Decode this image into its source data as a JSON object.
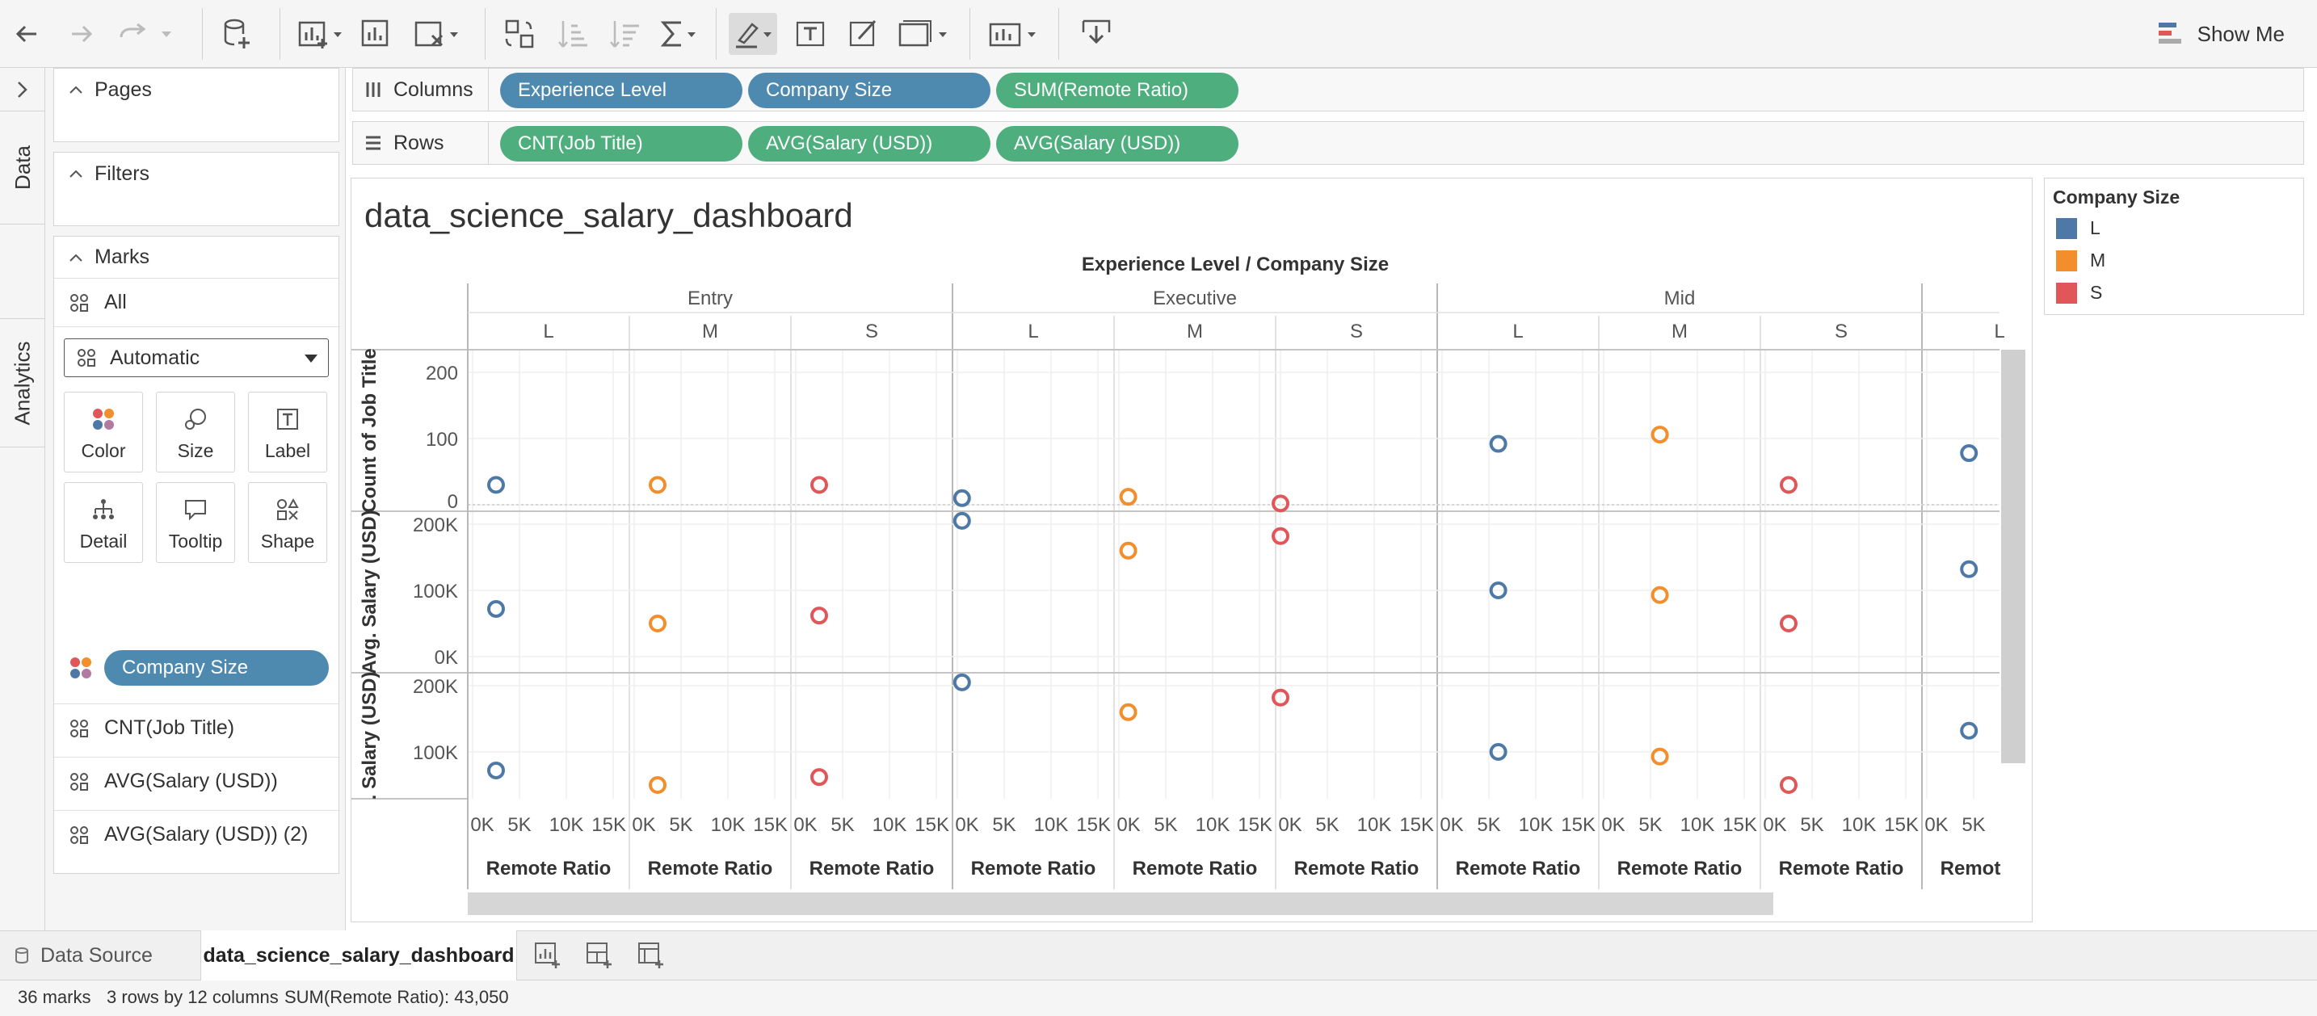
{
  "toolbar": {
    "undo_icon": "undo-arrow-icon",
    "redo_icon": "redo-arrow-icon",
    "show_me_label": "Show Me"
  },
  "side_tabs": {
    "data": "Data",
    "analytics": "Analytics"
  },
  "left_panel": {
    "pages_label": "Pages",
    "filters_label": "Filters",
    "marks_label": "Marks",
    "all_label": "All",
    "mark_type": "Automatic",
    "buttons": {
      "color": "Color",
      "size": "Size",
      "label": "Label",
      "detail": "Detail",
      "tooltip": "Tooltip",
      "shape": "Shape"
    },
    "color_pill": "Company Size",
    "measures": [
      "CNT(Job Title)",
      "AVG(Salary (USD))",
      "AVG(Salary (USD)) (2)"
    ]
  },
  "shelves": {
    "columns_label": "Columns",
    "rows_label": "Rows",
    "columns": [
      "Experience Level",
      "Company Size",
      "SUM(Remote Ratio)"
    ],
    "rows": [
      "CNT(Job Title)",
      "AVG(Salary (USD))",
      "AVG(Salary (USD))"
    ]
  },
  "view": {
    "title": "data_science_salary_dashboard",
    "header_title": "Experience Level / Company Size",
    "experience_levels": [
      "Entry",
      "Executive",
      "Mid",
      ""
    ],
    "company_sizes": [
      "L",
      "M",
      "S",
      "L",
      "M",
      "S",
      "L",
      "M",
      "S",
      "L"
    ],
    "x_tick_labels": [
      "0K",
      "5K",
      "10K",
      "15K"
    ],
    "x_axis_label": "Remote Ratio",
    "last_x_tick_labels": [
      "0K",
      "5K"
    ],
    "last_x_axis_label": "Remot",
    "row_axes": [
      {
        "label": "Count of Job Title",
        "ticks": [
          "200",
          "100",
          "0"
        ]
      },
      {
        "label": "Avg. Salary (USD)",
        "ticks": [
          "200K",
          "100K",
          "0K"
        ]
      },
      {
        "label": ". Salary (USD)",
        "ticks": [
          "200K",
          "100K"
        ]
      }
    ]
  },
  "legend": {
    "title": "Company Size",
    "items": [
      {
        "label": "L",
        "color": "#4e79a7"
      },
      {
        "label": "M",
        "color": "#f28e2b"
      },
      {
        "label": "S",
        "color": "#e15759"
      }
    ]
  },
  "tabs": {
    "data_source": "Data Source",
    "active_sheet": "data_science_salary_dashboard"
  },
  "status": {
    "marks": "36 marks",
    "dims": "3 rows by 12 columns",
    "sum": "SUM(Remote Ratio): 43,050"
  },
  "colors": {
    "L": "#4e79a7",
    "M": "#f28e2b",
    "S": "#e15759",
    "pill_blue": "#4e8aaf",
    "pill_green": "#4eae7d"
  },
  "chart_data": {
    "type": "scatter",
    "xlabel": "Remote Ratio",
    "panels": [
      {
        "level": "Entry",
        "size": "L",
        "remote_ratio": 2500,
        "count": 30,
        "avg_salary": 72000,
        "avg_salary_2": 72000
      },
      {
        "level": "Entry",
        "size": "M",
        "remote_ratio": 2500,
        "count": 30,
        "avg_salary": 50000,
        "avg_salary_2": 50000
      },
      {
        "level": "Entry",
        "size": "S",
        "remote_ratio": 2500,
        "count": 30,
        "avg_salary": 62000,
        "avg_salary_2": 62000
      },
      {
        "level": "Executive",
        "size": "L",
        "remote_ratio": 500,
        "count": 10,
        "avg_salary": 205000,
        "avg_salary_2": 205000
      },
      {
        "level": "Executive",
        "size": "M",
        "remote_ratio": 1000,
        "count": 12,
        "avg_salary": 160000,
        "avg_salary_2": 160000
      },
      {
        "level": "Executive",
        "size": "S",
        "remote_ratio": 0,
        "count": 2,
        "avg_salary": 182000,
        "avg_salary_2": 182000
      },
      {
        "level": "Mid",
        "size": "L",
        "remote_ratio": 6000,
        "count": 92,
        "avg_salary": 100000,
        "avg_salary_2": 100000
      },
      {
        "level": "Mid",
        "size": "M",
        "remote_ratio": 6000,
        "count": 106,
        "avg_salary": 93000,
        "avg_salary_2": 93000
      },
      {
        "level": "Mid",
        "size": "S",
        "remote_ratio": 2500,
        "count": 30,
        "avg_salary": 50000,
        "avg_salary_2": 50000
      },
      {
        "level": "",
        "size": "L",
        "remote_ratio": 4500,
        "count": 78,
        "avg_salary": 132000,
        "avg_salary_2": 132000
      }
    ]
  }
}
